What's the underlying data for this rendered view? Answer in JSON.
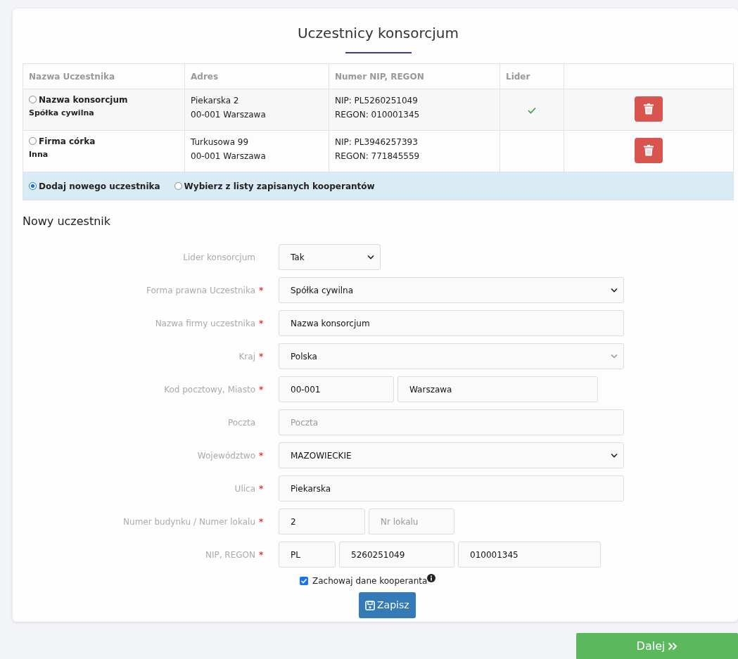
{
  "title": "Uczestnicy konsorcjum",
  "table": {
    "columns": [
      "Nazwa Uczestnika",
      "Adres",
      "Numer NIP, REGON",
      "Lider"
    ],
    "rows": [
      {
        "selected": false,
        "name": "Nazwa konsorcjum",
        "legal_form": "Spółka cywilna",
        "address": [
          "Piekarska 2",
          "00-001 Warszawa"
        ],
        "ids": [
          "NIP: PL5260251049",
          "REGON: 010001345"
        ],
        "leader": true
      },
      {
        "selected": false,
        "name": "Firma córka",
        "legal_form": "Inna",
        "address": [
          "Turkusowa 99",
          "00-001 Warszawa"
        ],
        "ids": [
          "NIP: PL3946257393",
          "REGON: 771845559"
        ],
        "leader": false
      }
    ]
  },
  "mode_options": [
    {
      "label": "Dodaj nowego uczestnika",
      "selected": true
    },
    {
      "label": "Wybierz z listy zapisanych kooperantów",
      "selected": false
    }
  ],
  "form": {
    "title": "Nowy uczestnik",
    "fields": [
      {
        "label": "Lider konsorcjum",
        "inputs": [
          {
            "kind": "select",
            "value": "Tak"
          }
        ]
      },
      {
        "label": "Forma prawna Uczestnika",
        "required_mark": "*",
        "inputs": [
          {
            "kind": "select",
            "value": "Spółka cywilna"
          }
        ]
      },
      {
        "label": "Nazwa firmy uczestnika",
        "required_mark": "*",
        "inputs": [
          {
            "kind": "text",
            "value": "Nazwa konsorcjum"
          }
        ]
      },
      {
        "label": "Kraj",
        "required_mark": "*",
        "inputs": [
          {
            "kind": "combo",
            "value": "Polska"
          }
        ]
      },
      {
        "label": "Kod pocztowy, Miasto",
        "required_mark": "*",
        "inputs": [
          {
            "kind": "text",
            "value": "00-001"
          },
          {
            "kind": "text",
            "value": "Warszawa"
          }
        ]
      },
      {
        "label": "Poczta",
        "inputs": [
          {
            "kind": "text",
            "placeholder": "Poczta"
          }
        ]
      },
      {
        "label": "Województwo",
        "required_mark": "*",
        "inputs": [
          {
            "kind": "select",
            "value": "MAZOWIECKIE"
          }
        ]
      },
      {
        "label": "Ulica",
        "required_mark": "*",
        "inputs": [
          {
            "kind": "text",
            "value": "Piekarska"
          }
        ]
      },
      {
        "label": "Numer budynku / Numer lokalu",
        "required_mark": "*",
        "inputs": [
          {
            "kind": "text",
            "value": "2"
          },
          {
            "kind": "text",
            "placeholder": "Nr lokalu"
          }
        ]
      },
      {
        "label": "NIP, REGON",
        "required_mark": "*",
        "inputs": [
          {
            "kind": "text",
            "value": "PL"
          },
          {
            "kind": "text",
            "value": "5260251049"
          },
          {
            "kind": "text",
            "value": "010001345"
          }
        ]
      }
    ],
    "keep_data": {
      "label": "Zachowaj dane kooperanta",
      "checked": true
    },
    "save_button": "Zapisz"
  },
  "next_button": "Dalej"
}
